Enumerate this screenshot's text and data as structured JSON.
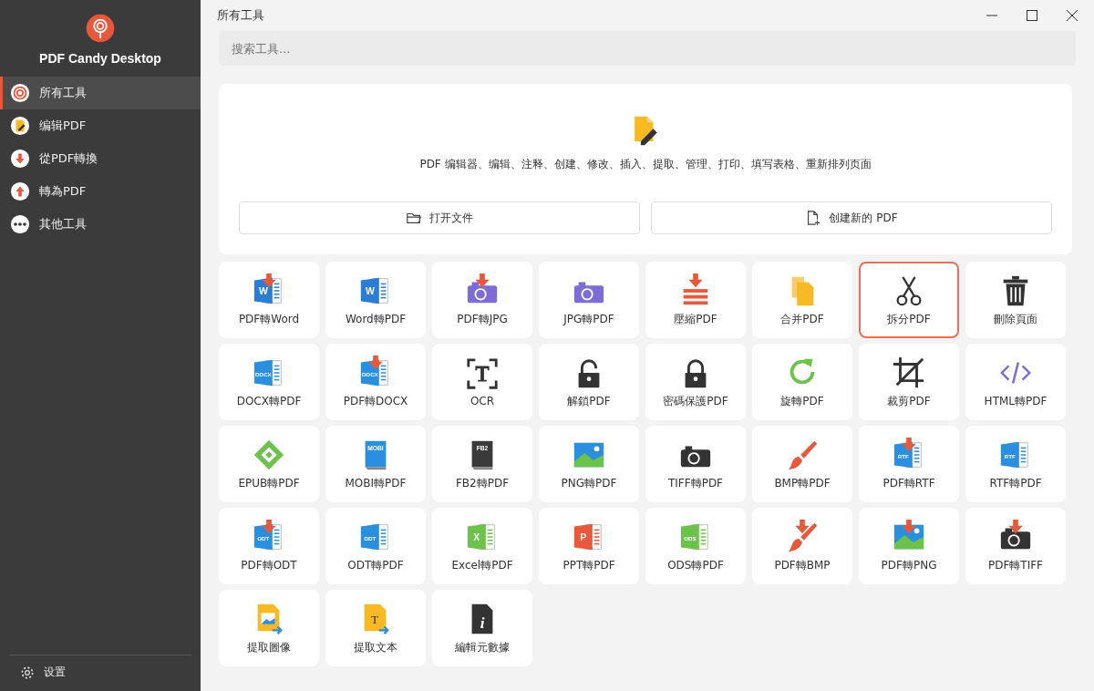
{
  "app": {
    "name": "PDF Candy Desktop"
  },
  "sidebar": {
    "items": [
      {
        "label": "所有工具",
        "selected": true
      },
      {
        "label": "编辑PDF",
        "selected": false
      },
      {
        "label": "從PDF轉換",
        "selected": false
      },
      {
        "label": "轉為PDF",
        "selected": false
      },
      {
        "label": "其他工具",
        "selected": false
      }
    ],
    "settings": "设置"
  },
  "window": {
    "title": "所有工具"
  },
  "search": {
    "placeholder": "搜索工具..."
  },
  "hero": {
    "description": "PDF 编辑器、编辑、注释、创建、修改、插入、提取、管理、打印、填写表格、重新排列页面",
    "buttons": [
      {
        "label": "打开文件"
      },
      {
        "label": "创建新的 PDF"
      }
    ]
  },
  "tools": [
    {
      "label": "PDF轉Word",
      "kind": "doc",
      "icon_text": "W",
      "color": "#2b7cd3",
      "arrow": true,
      "selected": false
    },
    {
      "label": "Word轉PDF",
      "kind": "doc",
      "icon_text": "W",
      "color": "#2b7cd3",
      "arrow": false,
      "selected": false
    },
    {
      "label": "PDF轉JPG",
      "kind": "camera",
      "color": "#7d6bd6",
      "arrow": true,
      "selected": false
    },
    {
      "label": "JPG轉PDF",
      "kind": "camera",
      "color": "#7d6bd6",
      "arrow": false,
      "selected": false
    },
    {
      "label": "壓縮PDF",
      "kind": "press",
      "color": "#e8593c",
      "arrow": true,
      "selected": false
    },
    {
      "label": "合并PDF",
      "kind": "files",
      "color": "#f7b924",
      "arrow": false,
      "selected": false
    },
    {
      "label": "拆分PDF",
      "kind": "scissors",
      "color": "#333333",
      "arrow": false,
      "selected": true
    },
    {
      "label": "刪除頁面",
      "kind": "trash",
      "color": "#333333",
      "arrow": false,
      "selected": false
    },
    {
      "label": "DOCX轉PDF",
      "kind": "doc",
      "icon_text": "DOCX",
      "color": "#2b8fe0",
      "arrow": false,
      "selected": false
    },
    {
      "label": "PDF轉DOCX",
      "kind": "doc",
      "icon_text": "DOCX",
      "color": "#2b8fe0",
      "arrow": true,
      "selected": false
    },
    {
      "label": "OCR",
      "kind": "ocr",
      "color": "#333333",
      "arrow": false,
      "selected": false
    },
    {
      "label": "解鎖PDF",
      "kind": "unlock",
      "color": "#333333",
      "arrow": false,
      "selected": false
    },
    {
      "label": "密碼保護PDF",
      "kind": "lock",
      "color": "#333333",
      "arrow": false,
      "selected": false
    },
    {
      "label": "旋轉PDF",
      "kind": "rotate",
      "color": "#6cc24a",
      "arrow": false,
      "selected": false
    },
    {
      "label": "裁剪PDF",
      "kind": "crop",
      "color": "#333333",
      "arrow": false,
      "selected": false
    },
    {
      "label": "HTML轉PDF",
      "kind": "code",
      "color": "#7d6bd6",
      "arrow": false,
      "selected": false
    },
    {
      "label": "EPUB轉PDF",
      "kind": "epub",
      "color": "#6cc24a",
      "arrow": false,
      "selected": false
    },
    {
      "label": "MOBI轉PDF",
      "kind": "book",
      "icon_text": "MOBI",
      "color": "#2b8fe0",
      "arrow": false,
      "selected": false
    },
    {
      "label": "FB2轉PDF",
      "kind": "book",
      "icon_text": "FB2",
      "color": "#3a3a3a",
      "arrow": false,
      "selected": false
    },
    {
      "label": "PNG轉PDF",
      "kind": "photo",
      "color": "#2b8fe0",
      "arrow": false,
      "selected": false
    },
    {
      "label": "TIFF轉PDF",
      "kind": "camera",
      "color": "#333333",
      "arrow": false,
      "selected": false
    },
    {
      "label": "BMP轉PDF",
      "kind": "brush",
      "color": "#e8593c",
      "arrow": false,
      "selected": false
    },
    {
      "label": "PDF轉RTF",
      "kind": "doc",
      "icon_text": "RTF",
      "color": "#2b8fe0",
      "arrow": true,
      "selected": false
    },
    {
      "label": "RTF轉PDF",
      "kind": "doc",
      "icon_text": "RTF",
      "color": "#2b8fe0",
      "arrow": false,
      "selected": false
    },
    {
      "label": "PDF轉ODT",
      "kind": "doc",
      "icon_text": "ODT",
      "color": "#2b8fe0",
      "arrow": true,
      "selected": false
    },
    {
      "label": "ODT轉PDF",
      "kind": "doc",
      "icon_text": "ODT",
      "color": "#2b8fe0",
      "arrow": false,
      "selected": false
    },
    {
      "label": "Excel轉PDF",
      "kind": "doc",
      "icon_text": "X",
      "color": "#6cc24a",
      "arrow": false,
      "selected": false
    },
    {
      "label": "PPT轉PDF",
      "kind": "doc",
      "icon_text": "P",
      "color": "#e8593c",
      "arrow": false,
      "selected": false
    },
    {
      "label": "ODS轉PDF",
      "kind": "doc",
      "icon_text": "ODS",
      "color": "#6cc24a",
      "arrow": false,
      "selected": false
    },
    {
      "label": "PDF轉BMP",
      "kind": "brush",
      "color": "#e8593c",
      "arrow": true,
      "selected": false
    },
    {
      "label": "PDF轉PNG",
      "kind": "photo",
      "color": "#2b8fe0",
      "arrow": true,
      "selected": false
    },
    {
      "label": "PDF轉TIFF",
      "kind": "camera",
      "color": "#333333",
      "arrow": true,
      "selected": false
    },
    {
      "label": "提取圖像",
      "kind": "extract",
      "color": "#f7b924",
      "arrow": false,
      "selected": false
    },
    {
      "label": "提取文本",
      "kind": "extract",
      "icon_text": "T",
      "color": "#f7b924",
      "arrow": false,
      "selected": false
    },
    {
      "label": "編輯元數據",
      "kind": "info",
      "icon_text": "i",
      "color": "#333333",
      "arrow": false,
      "selected": false
    }
  ]
}
